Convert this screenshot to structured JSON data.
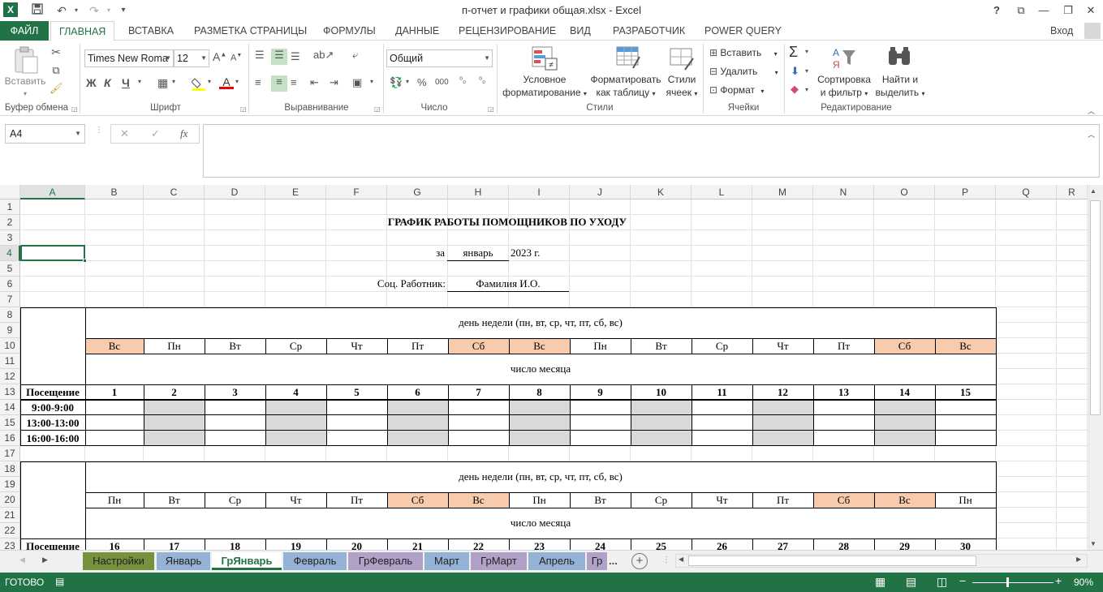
{
  "window": {
    "title": "п-отчет и графики общая.xlsx - Excel",
    "help": "?",
    "restore": "⧉",
    "minimize": "—",
    "maximize": "❐",
    "close": "✕"
  },
  "qat": {
    "save_icon": "save-icon",
    "undo": "↶",
    "redo": "↷",
    "customize": "▾"
  },
  "ribbon_tabs": [
    "ФАЙЛ",
    "ГЛАВНАЯ",
    "ВСТАВКА",
    "РАЗМЕТКА СТРАНИЦЫ",
    "ФОРМУЛЫ",
    "ДАННЫЕ",
    "РЕЦЕНЗИРОВАНИЕ",
    "ВИД",
    "РАЗРАБОТЧИК",
    "POWER QUERY"
  ],
  "signin": "Вход",
  "ribbon": {
    "clipboard": {
      "paste": "Вставить",
      "label": "Буфер обмена"
    },
    "font": {
      "name": "Times New Roma",
      "size": "12",
      "bold": "Ж",
      "italic": "К",
      "underline": "Ч",
      "label": "Шрифт"
    },
    "alignment": {
      "label": "Выравнивание"
    },
    "number": {
      "format": "Общий",
      "label": "Число",
      "percent": "%",
      "thousands": "000"
    },
    "styles": {
      "cond_line1": "Условное",
      "cond_line2": "форматирование",
      "table_line1": "Форматировать",
      "table_line2": "как таблицу",
      "cell_line1": "Стили",
      "cell_line2": "ячеек",
      "label": "Стили"
    },
    "cells": {
      "insert": "Вставить",
      "delete": "Удалить",
      "format": "Формат",
      "label": "Ячейки"
    },
    "editing": {
      "sort_line1": "Сортировка",
      "sort_line2": "и фильтр",
      "find_line1": "Найти и",
      "find_line2": "выделить",
      "label": "Редактирование"
    }
  },
  "formula_bar": {
    "name_box": "A4",
    "cancel": "✕",
    "enter": "✓",
    "fx": "fx",
    "value": ""
  },
  "columns": [
    "A",
    "B",
    "C",
    "D",
    "E",
    "F",
    "G",
    "H",
    "I",
    "J",
    "K",
    "L",
    "M",
    "N",
    "O",
    "P",
    "Q",
    "R"
  ],
  "rows": [
    "1",
    "2",
    "3",
    "4",
    "5",
    "6",
    "7",
    "8",
    "9",
    "10",
    "11",
    "12",
    "13",
    "14",
    "15",
    "16",
    "17",
    "18",
    "19",
    "20",
    "21",
    "22",
    "23"
  ],
  "sheet": {
    "title": "ГРАФИК РАБОТЫ ПОМОЩНИКОВ ПО УХОДУ",
    "period_prefix": "за",
    "month": "январь",
    "year": "2023 г.",
    "worker_label": "Соц. Работник:",
    "worker_name": "Фамилия И.О.",
    "weekday_header": "день недели (пн, вт, ср, чт, пт, сб, вс)",
    "daynum_header": "число месяца",
    "visit_label": "Посещение",
    "times": [
      "9:00-9:00",
      "13:00-13:00",
      "16:00-16:00"
    ],
    "block1": {
      "weekdays": [
        "Вс",
        "Пн",
        "Вт",
        "Ср",
        "Чт",
        "Пт",
        "Сб",
        "Вс",
        "Пн",
        "Вт",
        "Ср",
        "Чт",
        "Пт",
        "Сб",
        "Вс"
      ],
      "days": [
        "1",
        "2",
        "3",
        "4",
        "5",
        "6",
        "7",
        "8",
        "9",
        "10",
        "11",
        "12",
        "13",
        "14",
        "15"
      ]
    },
    "block2": {
      "weekdays": [
        "Пн",
        "Вт",
        "Ср",
        "Чт",
        "Пт",
        "Сб",
        "Вс",
        "Пн",
        "Вт",
        "Ср",
        "Чт",
        "Пт",
        "Сб",
        "Вс",
        "Пн"
      ],
      "days": [
        "16",
        "17",
        "18",
        "19",
        "20",
        "21",
        "22",
        "23",
        "24",
        "25",
        "26",
        "27",
        "28",
        "29",
        "30"
      ]
    },
    "weekend_color": "#f8cbad",
    "shade_color": "#d9d9d9"
  },
  "sheet_tabs": [
    {
      "label": "Настройки",
      "color": "#76923c"
    },
    {
      "label": "Январь",
      "color": "#95b3d7"
    },
    {
      "label": "ГрЯнварь",
      "color": "#ffffff"
    },
    {
      "label": "Февраль",
      "color": "#95b3d7"
    },
    {
      "label": "ГрФевраль",
      "color": "#b1a0c7"
    },
    {
      "label": "Март",
      "color": "#95b3d7"
    },
    {
      "label": "ГрМарт",
      "color": "#b1a0c7"
    },
    {
      "label": "Апрель",
      "color": "#95b3d7"
    },
    {
      "label": "Гр",
      "color": "#b1a0c7"
    }
  ],
  "sheet_more": "...",
  "status": {
    "ready": "ГОТОВО",
    "zoom": "90%"
  }
}
